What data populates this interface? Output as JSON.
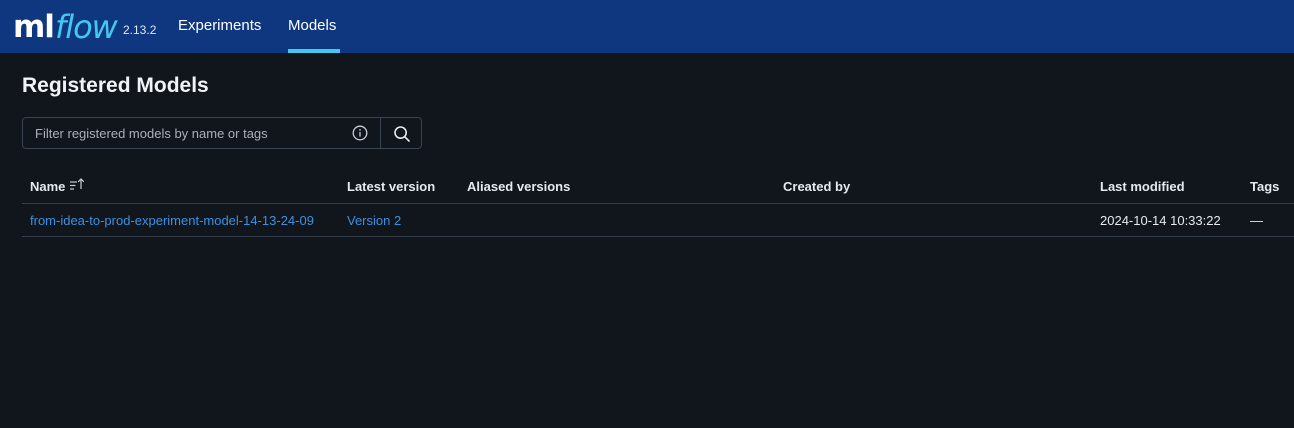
{
  "header": {
    "logo_ml": "ml",
    "logo_flow": "flow",
    "version": "2.13.2",
    "nav": [
      {
        "label": "Experiments",
        "active": false
      },
      {
        "label": "Models",
        "active": true
      }
    ],
    "background_color": "#0e3780",
    "accent_color": "#43c9ed"
  },
  "page": {
    "title": "Registered Models"
  },
  "search": {
    "placeholder": "Filter registered models by name or tags",
    "value": "",
    "info_icon": "info-icon",
    "search_icon": "search-icon"
  },
  "table": {
    "columns": [
      "Name",
      "Latest version",
      "Aliased versions",
      "Created by",
      "Last modified",
      "Tags"
    ],
    "sort_icon": "sort-ascending-icon",
    "rows": [
      {
        "name": "from-idea-to-prod-experiment-model-14-13-24-09",
        "latest_version": "Version 2",
        "aliased_versions": "",
        "created_by": "",
        "last_modified": "2024-10-14 10:33:22",
        "tags": "—"
      }
    ]
  }
}
